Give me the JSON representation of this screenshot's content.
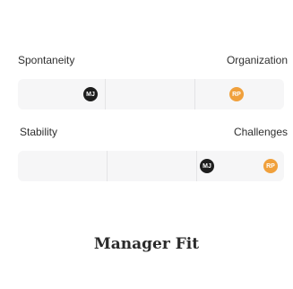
{
  "sliders": [
    {
      "left_label": "Spontaneity",
      "right_label": "Organization",
      "markers": [
        {
          "initials": "MJ",
          "color": "#1e1e1e"
        },
        {
          "initials": "RP",
          "color": "#f0a03c"
        }
      ]
    },
    {
      "left_label": "Stability",
      "right_label": "Challenges",
      "markers": [
        {
          "initials": "MJ",
          "color": "#1e1e1e"
        },
        {
          "initials": "RP",
          "color": "#f0a03c"
        }
      ]
    }
  ],
  "section_title": "Manager Fit"
}
